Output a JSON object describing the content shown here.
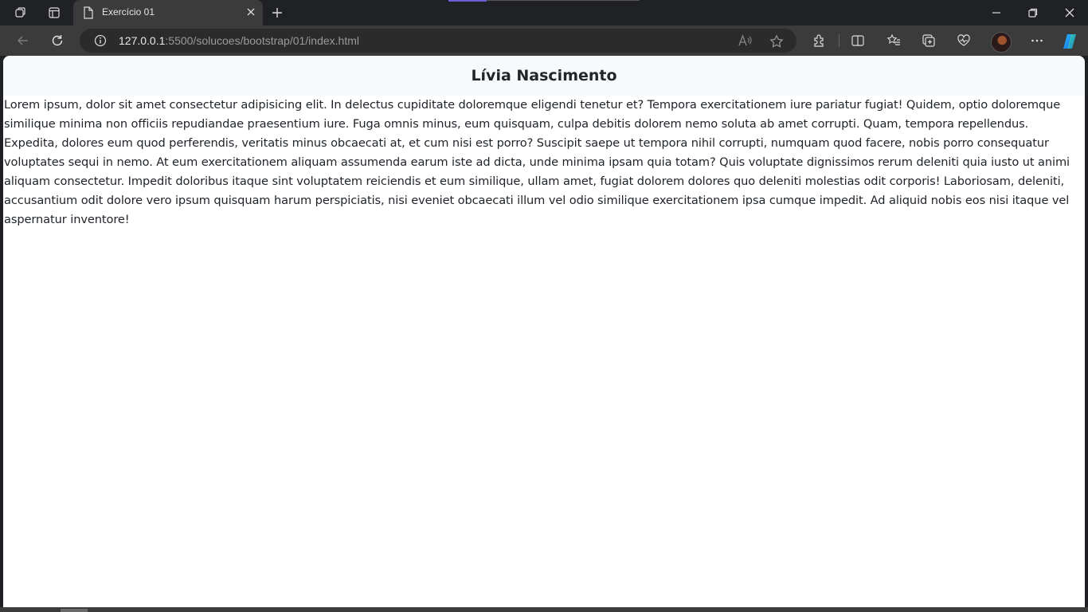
{
  "browser": {
    "tab": {
      "title": "Exercício 01"
    },
    "address": {
      "host": "127.0.0.1",
      "rest": ":5500/solucoes/bootstrap/01/index.html"
    },
    "icons": [
      "workspaces-icon",
      "tab-actions-icon",
      "page-icon",
      "close-tab-icon",
      "new-tab-icon",
      "minimize-icon",
      "restore-icon",
      "close-window-icon",
      "back-icon",
      "refresh-icon",
      "site-info-icon",
      "read-aloud-icon",
      "favorite-star-icon",
      "extensions-icon",
      "split-screen-icon",
      "favorites-icon",
      "collections-icon",
      "browser-essentials-icon",
      "more-options-icon",
      "copilot-icon"
    ],
    "accent_color": "#6b5fd6"
  },
  "page": {
    "heading": "Lívia Nascimento",
    "paragraph": "Lorem ipsum, dolor sit amet consectetur adipisicing elit. In delectus cupiditate doloremque eligendi tenetur et? Tempora exercitationem iure pariatur fugiat! Quidem, optio doloremque similique minima non officiis repudiandae praesentium iure. Fuga omnis minus, eum quisquam, culpa debitis dolorem nemo soluta ab amet corrupti. Quam, tempora repellendus. Expedita, dolores eum quod perferendis, veritatis minus obcaecati at, et cum nisi est porro? Suscipit saepe ut tempora nihil corrupti, numquam quod facere, nobis porro consequatur voluptates sequi in nemo. At eum exercitationem aliquam assumenda earum iste ad dicta, unde minima ipsam quia totam? Quis voluptate dignissimos rerum deleniti quia iusto ut animi aliquam consectetur. Impedit doloribus itaque sint voluptatem reiciendis et eum similique, ullam amet, fugiat dolorem dolores quo deleniti molestias odit corporis! Laboriosam, deleniti, accusantium odit dolore vero ipsum quisquam harum perspiciatis, nisi eveniet obcaecati illum vel odio similique exercitationem ipsa cumque impedit. Ad aliquid nobis eos nisi itaque vel aspernatur inventore!"
  }
}
